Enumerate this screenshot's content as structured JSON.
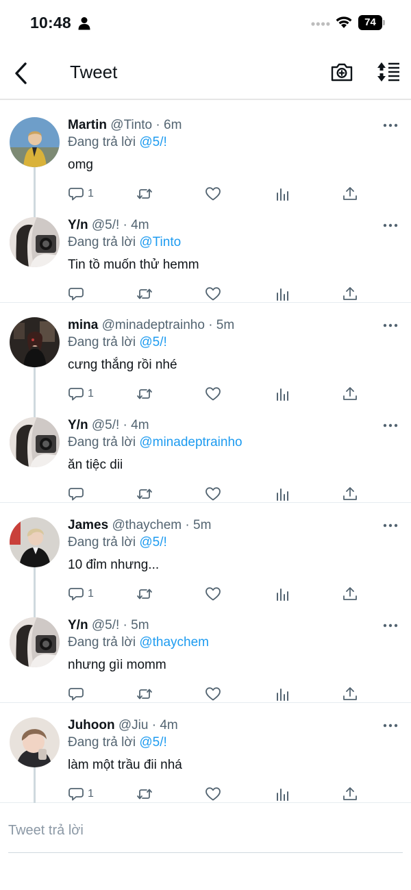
{
  "status_bar": {
    "time": "10:48",
    "battery": "74",
    "icons": [
      "person-icon",
      "signal-dots-icon",
      "wifi-icon",
      "battery-icon"
    ]
  },
  "header": {
    "title": "Tweet",
    "icons": [
      "back-chevron-icon",
      "camera-plus-icon",
      "sort-icon"
    ]
  },
  "colors": {
    "accent": "#1d9bf0",
    "secondary_text": "#536471",
    "primary_text": "#0f1419",
    "thread_line": "#cfd9de"
  },
  "groups": [
    {
      "tweets": [
        {
          "name": "Martin",
          "handle": "@Tinto",
          "time": "· 6m",
          "reply_prefix": "Đang trả lời",
          "mention": "@5/!",
          "text": "omg",
          "reply_count": "1",
          "avatar": "avatar-martin"
        },
        {
          "name": "Y/n",
          "handle": "@5/!",
          "time": "· 4m",
          "reply_prefix": "Đang trả lời",
          "mention": "@Tinto",
          "text": "Tin tồ muốn thử hemm",
          "reply_count": "",
          "avatar": "avatar-yn"
        }
      ]
    },
    {
      "tweets": [
        {
          "name": "mina",
          "handle": "@minadeptrainho",
          "time": "· 5m",
          "reply_prefix": "Đang trả lời",
          "mention": "@5/!",
          "text": "cưng thắng rồi nhé",
          "reply_count": "1",
          "avatar": "avatar-mina"
        },
        {
          "name": "Y/n",
          "handle": "@5/!",
          "time": "· 4m",
          "reply_prefix": "Đang trả lời",
          "mention": "@minadeptrainho",
          "text": "ăn tiệc dii",
          "reply_count": "",
          "avatar": "avatar-yn"
        }
      ]
    },
    {
      "tweets": [
        {
          "name": "James",
          "handle": "@thaychem",
          "time": "· 5m",
          "reply_prefix": "Đang trả lời",
          "mention": "@5/!",
          "text": "10 đỉm nhưng...",
          "reply_count": "1",
          "avatar": "avatar-james"
        },
        {
          "name": "Y/n",
          "handle": "@5/!",
          "time": "· 5m",
          "reply_prefix": "Đang trả lời",
          "mention": "@thaychem",
          "text": "nhưng gìi momm",
          "reply_count": "",
          "avatar": "avatar-yn"
        }
      ]
    },
    {
      "tweets": [
        {
          "name": "Juhoon",
          "handle": "@Jiu",
          "time": "· 4m",
          "reply_prefix": "Đang trả lời",
          "mention": "@5/!",
          "text": "làm một trầu đii nhá",
          "reply_count": "1",
          "avatar": "avatar-juhoon"
        }
      ]
    }
  ],
  "tweet_actions": [
    "reply-icon",
    "retweet-icon",
    "like-icon",
    "analytics-icon",
    "share-icon"
  ],
  "reply_composer": {
    "placeholder": "Tweet trả lời"
  }
}
